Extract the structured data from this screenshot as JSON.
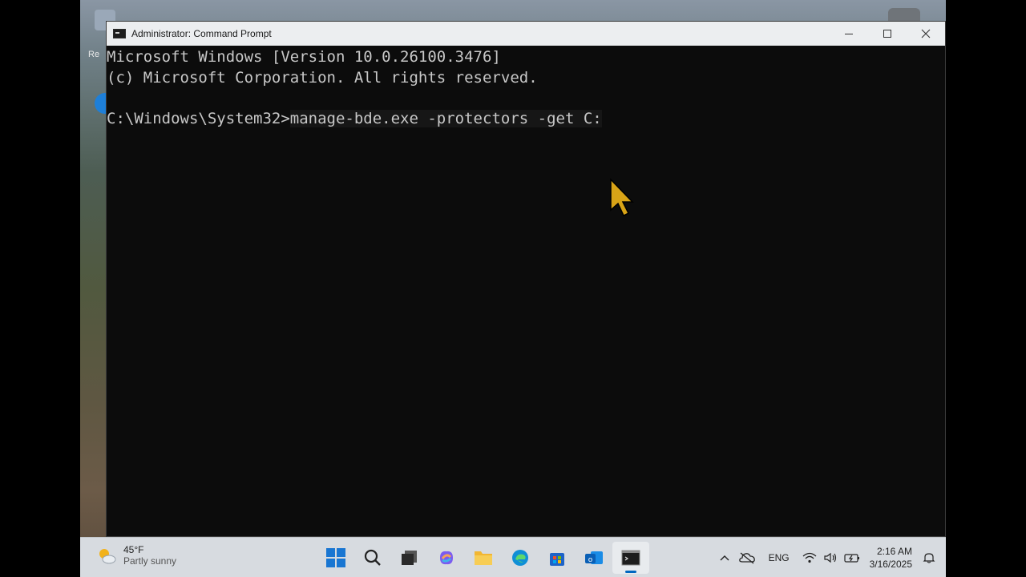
{
  "window": {
    "title": "Administrator: Command Prompt"
  },
  "console": {
    "lines": [
      "Microsoft Windows [Version 10.0.26100.3476]",
      "(c) Microsoft Corporation. All rights reserved.",
      ""
    ],
    "prompt": "C:\\Windows\\System32>",
    "command": "manage-bde.exe -protectors -get C:"
  },
  "desktop": {
    "icon_labels": [
      "Re"
    ]
  },
  "taskbar": {
    "weather": {
      "temp": "45°F",
      "condition": "Partly sunny"
    },
    "apps": [
      "start-icon",
      "search-icon",
      "task-view-icon",
      "copilot-icon",
      "file-explorer-icon",
      "edge-icon",
      "store-icon",
      "outlook-icon",
      "terminal-icon"
    ],
    "tray": {
      "language": "ENG",
      "time": "2:16 AM",
      "date": "3/16/2025"
    }
  },
  "colors": {
    "console_bg": "#0c0c0c",
    "console_text": "#c8c8c8",
    "titlebar_bg": "#eceef0",
    "taskbar_bg": "#d7dbe0",
    "accent": "#0067c0"
  }
}
